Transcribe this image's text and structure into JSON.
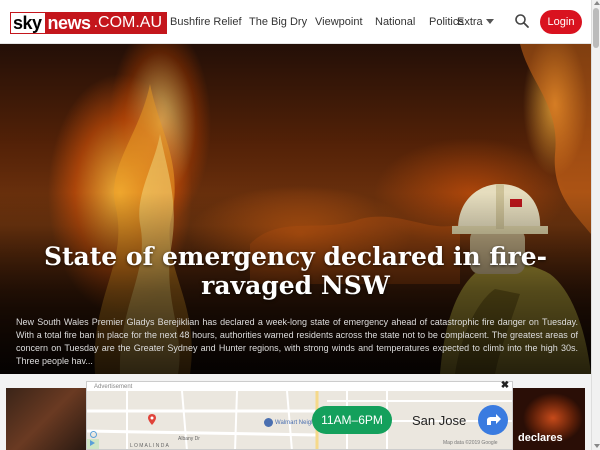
{
  "header": {
    "logo": {
      "sky": "sky",
      "news": "news",
      "domain": ".COM.AU"
    },
    "nav": [
      {
        "label": "Bushfire Relief"
      },
      {
        "label": "The Big Dry"
      },
      {
        "label": "Viewpoint"
      },
      {
        "label": "National"
      },
      {
        "label": "Politics"
      },
      {
        "label": "Extra"
      }
    ],
    "login_label": "Login"
  },
  "hero": {
    "title": "State of emergency declared in fire-ravaged NSW",
    "summary": "New South Wales Premier Gladys Berejiklian has declared a week-long state of emergency ahead of catastrophic fire danger on Tuesday. With a total fire ban in place for the next 48 hours, authorities warned residents across the state not to be complacent. The greatest areas of concern on Tuesday are the Greater Sydney and Hunter regions, with strong winds and temperatures expected to climb into the high 30s. Three people hav..."
  },
  "ad": {
    "label": "Advertisement",
    "hours": "11AM–6PM",
    "city": "San Jose",
    "map_store": "Walmart Neighborh",
    "map_street_1": "Albany Dr",
    "map_street_2": "L O M A   L I N D A",
    "map_attribution": "Map data ©2019 Google",
    "close_label": "✖"
  },
  "right_card": {
    "label": "declares"
  },
  "colors": {
    "brand_red": "#c4161c",
    "login_red": "#d9121f",
    "hours_green": "#14a05c",
    "direction_blue": "#3a7be0"
  }
}
